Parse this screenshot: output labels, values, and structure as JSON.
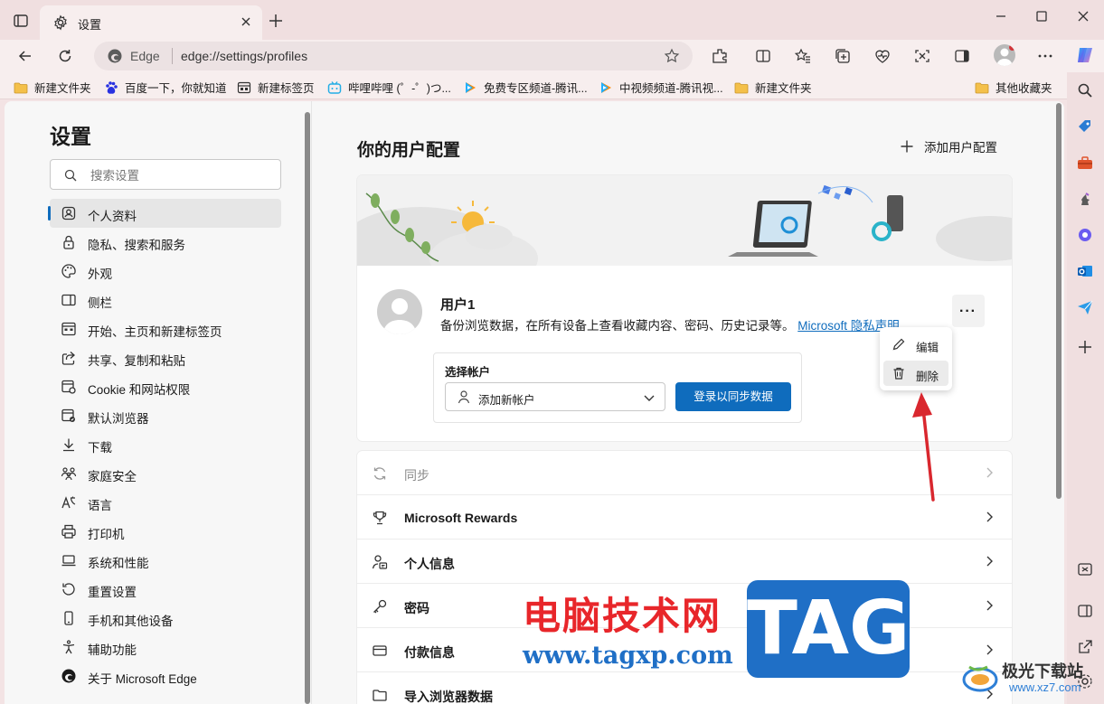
{
  "window": {
    "tab_title": "设置"
  },
  "address": {
    "site_label": "Edge",
    "url": "edge://settings/profiles"
  },
  "bookmarks": [
    {
      "label": "新建文件夹",
      "icon": "folder-icon"
    },
    {
      "label": "百度一下，你就知道",
      "icon": "baidu-icon"
    },
    {
      "label": "新建标签页",
      "icon": "newtab-icon"
    },
    {
      "label": "哔哩哔哩 (゜-゜)つ...",
      "icon": "bilibili-icon"
    },
    {
      "label": "免费专区频道-腾讯...",
      "icon": "tencent-video-icon"
    },
    {
      "label": "中视频频道-腾讯视...",
      "icon": "tencent-video-icon"
    },
    {
      "label": "新建文件夹",
      "icon": "folder-icon"
    },
    {
      "label": "其他收藏夹",
      "icon": "folder-icon"
    }
  ],
  "settings": {
    "title": "设置",
    "search_placeholder": "搜索设置",
    "nav": [
      {
        "label": "个人资料",
        "active": true
      },
      {
        "label": "隐私、搜索和服务"
      },
      {
        "label": "外观"
      },
      {
        "label": "侧栏"
      },
      {
        "label": "开始、主页和新建标签页"
      },
      {
        "label": "共享、复制和粘贴"
      },
      {
        "label": "Cookie 和网站权限"
      },
      {
        "label": "默认浏览器"
      },
      {
        "label": "下载"
      },
      {
        "label": "家庭安全"
      },
      {
        "label": "语言"
      },
      {
        "label": "打印机"
      },
      {
        "label": "系统和性能"
      },
      {
        "label": "重置设置"
      },
      {
        "label": "手机和其他设备"
      },
      {
        "label": "辅助功能"
      },
      {
        "label": "关于 Microsoft Edge"
      }
    ]
  },
  "profiles": {
    "heading": "你的用户配置",
    "add_label": "添加用户配置",
    "user_name": "用户1",
    "description": "备份浏览数据，在所有设备上查看收藏内容、密码、历史记录等。",
    "privacy_link": "Microsoft 隐私声明",
    "more_label": "···",
    "choose_account_label": "选择帐户",
    "account_value": "添加新帐户",
    "signin_button": "登录以同步数据",
    "menu": {
      "edit": "编辑",
      "delete": "删除"
    },
    "rows": [
      {
        "label": "同步",
        "disabled": true
      },
      {
        "label": "Microsoft Rewards"
      },
      {
        "label": "个人信息"
      },
      {
        "label": "密码"
      },
      {
        "label": "付款信息"
      },
      {
        "label": "导入浏览器数据"
      }
    ]
  },
  "watermark": {
    "cn_text": "电脑技术网",
    "url": "www.tagxp.com",
    "tag": "TAG",
    "corner_title": "极光下载站",
    "corner_url": "www.xz7.com"
  },
  "colors": {
    "accent": "#0f6cbd",
    "titlebar": "#f0dfe0",
    "annotation_arrow": "#d9272e",
    "watermark_red": "#e8262a",
    "watermark_blue": "#1f6fc6"
  }
}
